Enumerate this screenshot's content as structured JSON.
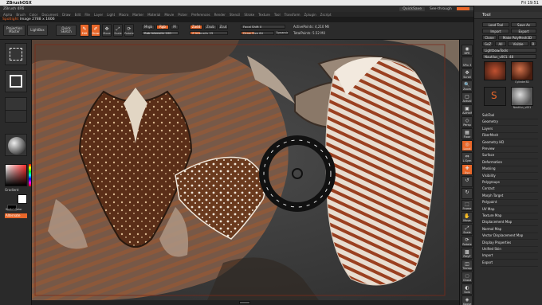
{
  "mac": {
    "apple": "",
    "app_name": "ZBrushOSX",
    "menus": [
      "ZBrush",
      "File",
      "Edit",
      "Window",
      "Help"
    ],
    "right": [
      "Fri 19:51"
    ]
  },
  "title": {
    "app": "ZBrush 4R6",
    "quicksave": "QuickSave",
    "seethrough": "See-through",
    "seethrough_value": 0,
    "menus_label": "Menus",
    "script": "DefaultZScript"
  },
  "menubar": [
    "Alpha",
    "Brush",
    "Color",
    "Document",
    "Draw",
    "Edit",
    "File",
    "Layer",
    "Light",
    "Macro",
    "Marker",
    "Material",
    "Movie",
    "Picker",
    "Preferences",
    "Render",
    "Stencil",
    "Stroke",
    "Texture",
    "Tool",
    "Transform",
    "Zplugin",
    "Zscript"
  ],
  "spotlight": {
    "label": "Spotlight",
    "value": "Image 2788 x 1606"
  },
  "shelf": {
    "projection_master": "Projection Master",
    "lightbox": "LightBox",
    "quick_sketch": "Quick Sketch",
    "edit": "Edit",
    "draw": "Draw",
    "move": "Move",
    "scale": "Scale",
    "rotate": "Rotate",
    "mrgb": "Mrgb",
    "rgb": "Rgb",
    "m": "M",
    "rgb_intensity": "Rgb Intensity 100",
    "zadd": "Zadd",
    "zsub": "Zsub",
    "zcut": "Zcut",
    "z_intensity": "Z Intensity 25",
    "focal_shift_label": "Focal Shift",
    "focal_shift": "0",
    "draw_size_label": "Draw Size",
    "draw_size": "64",
    "dynamic": "Dynamic",
    "active_points": "ActivePoints: 4,210 Mil",
    "total_points": "TotalPoints: 5.52 Mil"
  },
  "left": {
    "gradient": "Gradient",
    "switch_color": "SwitchColor",
    "alternate": "Alternate"
  },
  "right_shelf": [
    {
      "label": "BPR",
      "glyph": "◉",
      "on": false
    },
    {
      "label": "SPix 3",
      "glyph": "",
      "on": false
    },
    {
      "label": "Scroll",
      "glyph": "✥",
      "on": false
    },
    {
      "label": "Zoom",
      "glyph": "🔍",
      "on": false
    },
    {
      "label": "Actual",
      "glyph": "▢",
      "on": false
    },
    {
      "label": "AAHalf",
      "glyph": "▣",
      "on": false
    },
    {
      "label": "Persp",
      "glyph": "◇",
      "on": false
    },
    {
      "label": "Floor",
      "glyph": "▦",
      "on": false
    },
    {
      "label": "Local",
      "glyph": "◎",
      "on": true
    },
    {
      "label": "L.Sym",
      "glyph": "⇔",
      "on": false
    },
    {
      "label": "Xyz",
      "glyph": "✚",
      "on": true
    },
    {
      "label": "",
      "glyph": "↺",
      "on": false
    },
    {
      "label": "",
      "glyph": "↻",
      "on": false
    },
    {
      "label": "Frame",
      "glyph": "⬚",
      "on": false
    },
    {
      "label": "Move",
      "glyph": "✋",
      "on": false
    },
    {
      "label": "Scale",
      "glyph": "⤢",
      "on": false
    },
    {
      "label": "Rotate",
      "glyph": "⟳",
      "on": false
    },
    {
      "label": "PolyF",
      "glyph": "▩",
      "on": false
    },
    {
      "label": "Transp",
      "glyph": "◫",
      "on": false
    },
    {
      "label": "Ghost",
      "glyph": "◌",
      "on": false
    },
    {
      "label": "Solo",
      "glyph": "◐",
      "on": false
    },
    {
      "label": "Xpose",
      "glyph": "◈",
      "on": false
    }
  ],
  "tool": {
    "title": "Tool",
    "load_tool": "Load Tool",
    "save_as": "Save As",
    "import": "Import",
    "export": "Export",
    "clone": "Clone",
    "make_polymesh": "Make PolyMesh3D",
    "goz": "GoZ",
    "all": "All",
    "visible": "Visible",
    "r": "R",
    "lightbox_tools": "Lightbox▸Tools",
    "current_tool": "Nautilus_v001. 48",
    "thumbs": [
      "",
      "Cylinder3D",
      "Sphere3D",
      "Nautilus_v001"
    ],
    "menu": [
      "SubTool",
      "Geometry",
      "Layers",
      "FiberMesh",
      "Geometry HD",
      "Preview",
      "Surface",
      "Deformation",
      "Masking",
      "Visibility",
      "Polygroups",
      "Contact",
      "Morph Target",
      "Polypaint",
      "UV Map",
      "Texture Map",
      "Displacement Map",
      "Normal Map",
      "Vector Displacement Map",
      "Display Properties",
      "Unified Skin",
      "Import",
      "Export"
    ]
  },
  "colors": {
    "accent": "#e8672a",
    "panel": "#2b2b2b",
    "canvas": "#3f3f3f"
  }
}
